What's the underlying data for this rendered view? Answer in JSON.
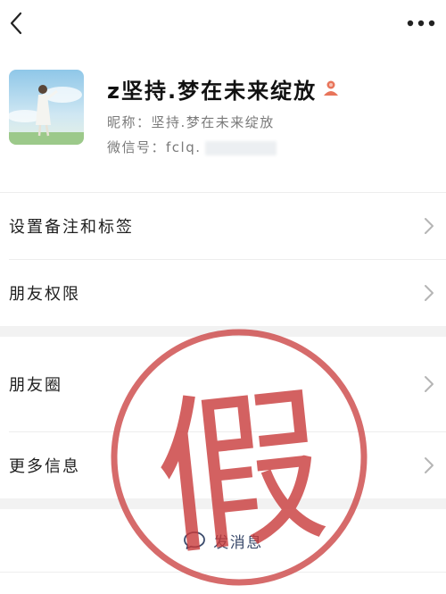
{
  "header": {
    "back_icon": "back-chevron-icon",
    "more_icon": "more-dots-icon"
  },
  "profile": {
    "display_name": "z坚持.梦在未来绽放",
    "badge_icon": "person-badge-icon",
    "nickname_line": "昵称：坚持.梦在未来绽放",
    "wechat_id_line": "微信号：fclq."
  },
  "rows": {
    "remark_label": "设置备注和标签",
    "permissions_label": "朋友权限",
    "moments_label": "朋友圈",
    "more_info_label": "更多信息"
  },
  "send_message": {
    "label": "发消息",
    "icon": "chat-bubble-icon"
  },
  "stamp": {
    "text": "假",
    "color": "#c83a3a"
  },
  "colors": {
    "background": "#ffffff",
    "section_gap": "#f2f2f2",
    "secondary_text": "#7a7a7a",
    "link_text": "#3a4a6b"
  }
}
